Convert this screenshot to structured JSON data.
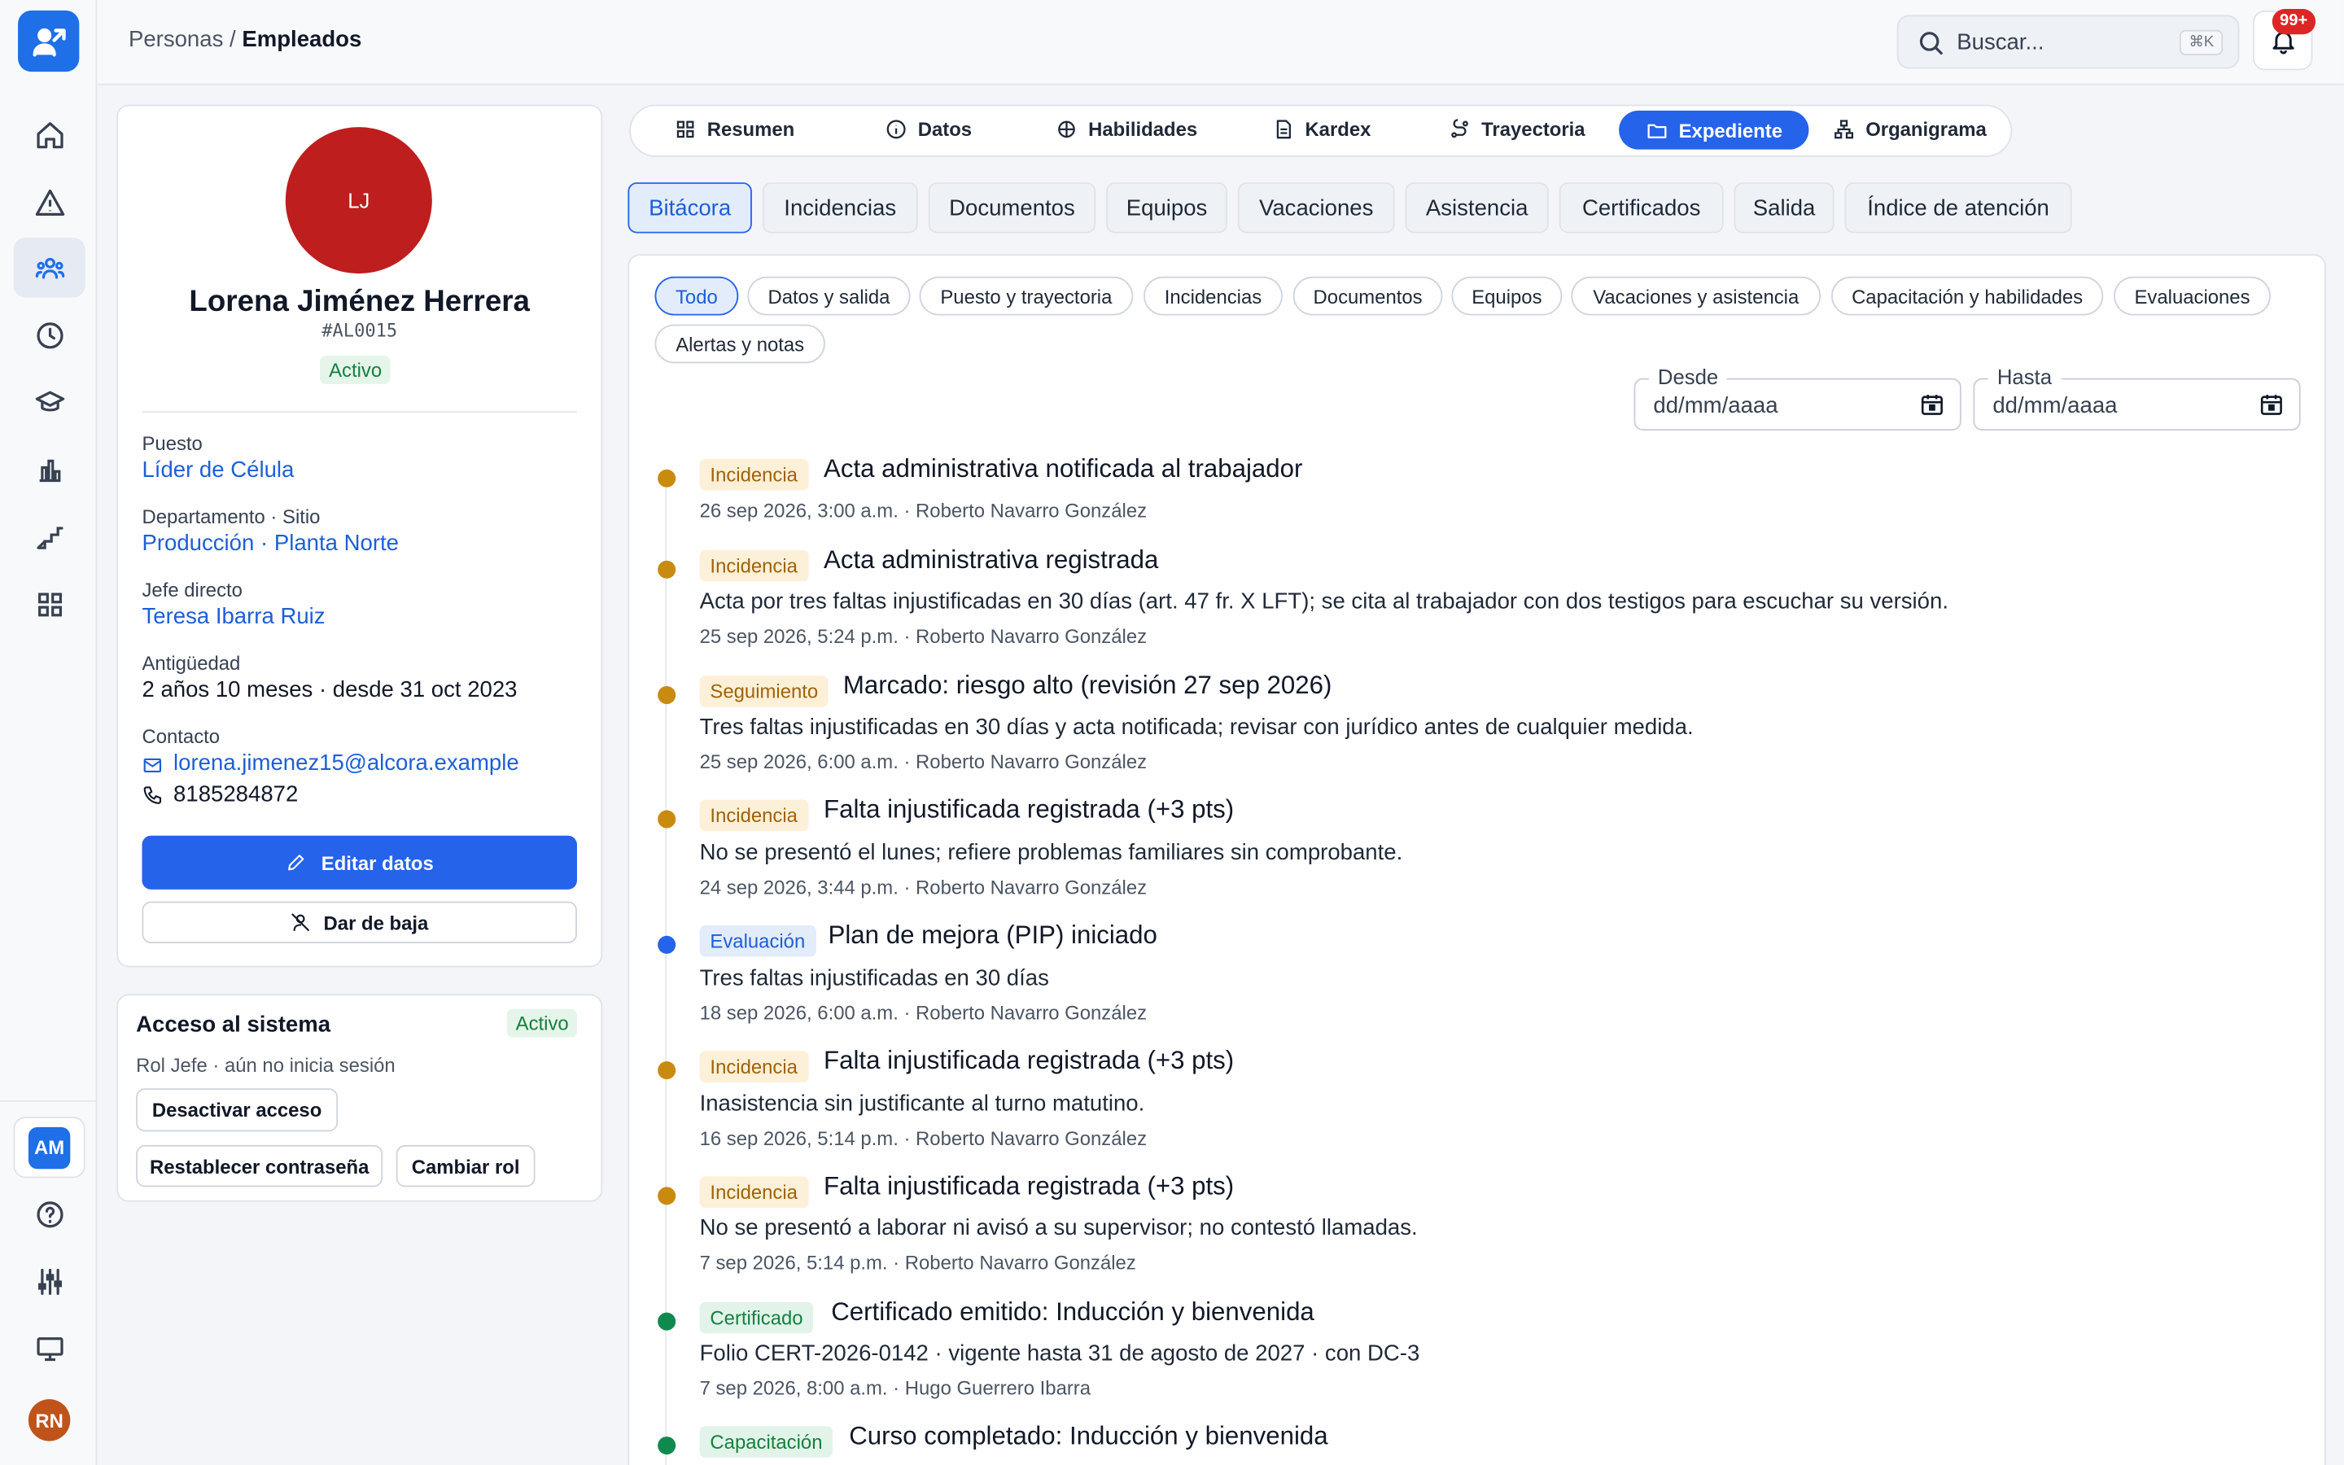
{
  "app": {
    "logo_icon": "user-arrow-icon"
  },
  "breadcrumb": {
    "parent": "Personas",
    "separator": " / ",
    "current": "Empleados"
  },
  "search": {
    "placeholder": "Buscar...",
    "shortcut": "⌘K"
  },
  "notifications": {
    "count": "99+"
  },
  "user": {
    "initials": "AM",
    "avatar_initials": "RN"
  },
  "employee": {
    "initials": "LJ",
    "name": "Lorena Jiménez Herrera",
    "id": "#AL0015",
    "status": "Activo",
    "puesto_label": "Puesto",
    "puesto": "Líder de Célula",
    "dept_label": "Departamento · Sitio",
    "departamento": "Producción",
    "dept_sep": " · ",
    "sitio": "Planta Norte",
    "jefe_label": "Jefe directo",
    "jefe": "Teresa Ibarra Ruiz",
    "antiguedad_label": "Antigüedad",
    "antiguedad": "2 años 10 meses · desde 31 oct 2023",
    "contacto_label": "Contacto",
    "email": "lorena.jimenez15@alcora.example",
    "phone": "8185284872",
    "edit_label": "Editar datos",
    "baja_label": "Dar de baja"
  },
  "access": {
    "title": "Acceso al sistema",
    "status": "Activo",
    "role_text": "Rol Jefe · aún no inicia sesión",
    "deactivate": "Desactivar acceso",
    "reset": "Restablecer contraseña",
    "change_role": "Cambiar rol"
  },
  "main_tabs": [
    {
      "label": "Resumen",
      "icon": "grid-icon"
    },
    {
      "label": "Datos",
      "icon": "info-icon"
    },
    {
      "label": "Habilidades",
      "icon": "brain-icon"
    },
    {
      "label": "Kardex",
      "icon": "document-icon"
    },
    {
      "label": "Trayectoria",
      "icon": "route-icon"
    },
    {
      "label": "Expediente",
      "icon": "folder-icon"
    },
    {
      "label": "Organigrama",
      "icon": "org-chart-icon"
    }
  ],
  "sub_tabs": [
    "Bitácora",
    "Incidencias",
    "Documentos",
    "Equipos",
    "Vacaciones",
    "Asistencia",
    "Certificados",
    "Salida",
    "Índice de atención"
  ],
  "filters": [
    "Todo",
    "Datos y salida",
    "Puesto y trayectoria",
    "Incidencias",
    "Documentos",
    "Equipos",
    "Vacaciones y asistencia",
    "Capacitación y habilidades",
    "Evaluaciones",
    "Alertas y notas"
  ],
  "date_filter": {
    "from_label": "Desde",
    "to_label": "Hasta",
    "placeholder": "dd/mm/aaaa"
  },
  "colors": {
    "accent": "#2563eb",
    "incidencia": "#c98a10",
    "evaluacion": "#2563eb",
    "certificado": "#0f8a4f"
  },
  "events": [
    {
      "tag": "Incidencia",
      "title": "Acta administrativa notificada al trabajador",
      "desc": "",
      "meta": "26 sep 2026, 3:00 a.m. · Roberto Navarro González"
    },
    {
      "tag": "Incidencia",
      "title": "Acta administrativa registrada",
      "desc": "Acta por tres faltas injustificadas en 30 días (art. 47 fr. X LFT); se cita al trabajador con dos testigos para escuchar su versión.",
      "meta": "25 sep 2026, 5:24 p.m. · Roberto Navarro González"
    },
    {
      "tag": "Seguimiento",
      "title": "Marcado: riesgo alto (revisión 27 sep 2026)",
      "desc": "Tres faltas injustificadas en 30 días y acta notificada; revisar con jurídico antes de cualquier medida.",
      "meta": "25 sep 2026, 6:00 a.m. · Roberto Navarro González"
    },
    {
      "tag": "Incidencia",
      "title": "Falta injustificada registrada (+3 pts)",
      "desc": "No se presentó el lunes; refiere problemas familiares sin comprobante.",
      "meta": "24 sep 2026, 3:44 p.m. · Roberto Navarro González"
    },
    {
      "tag": "Evaluación",
      "title": "Plan de mejora (PIP) iniciado",
      "desc": "Tres faltas injustificadas en 30 días",
      "meta": "18 sep 2026, 6:00 a.m. · Roberto Navarro González"
    },
    {
      "tag": "Incidencia",
      "title": "Falta injustificada registrada (+3 pts)",
      "desc": "Inasistencia sin justificante al turno matutino.",
      "meta": "16 sep 2026, 5:14 p.m. · Roberto Navarro González"
    },
    {
      "tag": "Incidencia",
      "title": "Falta injustificada registrada (+3 pts)",
      "desc": "No se presentó a laborar ni avisó a su supervisor; no contestó llamadas.",
      "meta": "7 sep 2026, 5:14 p.m. · Roberto Navarro González"
    },
    {
      "tag": "Certificado",
      "title": "Certificado emitido: Inducción y bienvenida",
      "desc": "Folio CERT-2026-0142 · vigente hasta 31 de agosto de 2027 · con DC-3",
      "meta": "7 sep 2026, 8:00 a.m. · Hugo Guerrero Ibarra"
    },
    {
      "tag": "Capacitación",
      "title": "Curso completado: Inducción y bienvenida",
      "desc": "",
      "meta": ""
    }
  ]
}
